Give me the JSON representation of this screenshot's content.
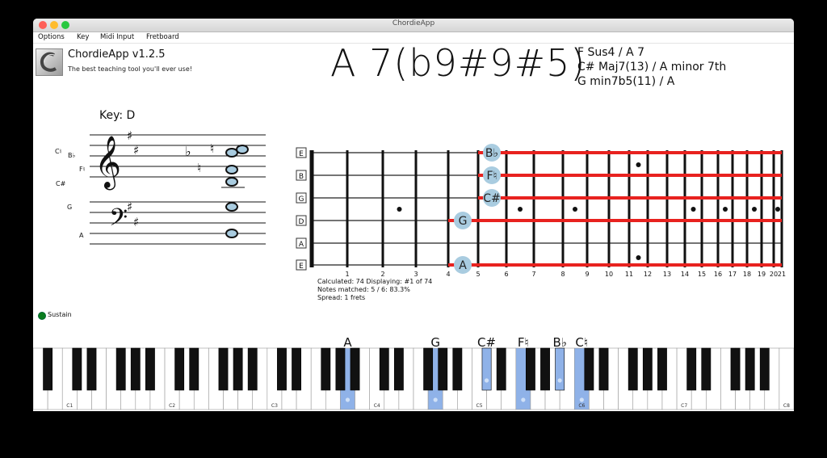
{
  "window": {
    "title": "ChordieApp",
    "close_color": "#fe5f57",
    "min_color": "#febc2e",
    "max_color": "#28c840"
  },
  "menu": [
    "Options",
    "Key",
    "Midi Input",
    "Fretboard"
  ],
  "app": {
    "name": "ChordieApp v1.2.5",
    "tagline": "The best teaching tool you'll ever use!"
  },
  "chord": {
    "main": "A 7(b9#9#5)",
    "alternates": [
      "F Sus4 / A 7",
      "C# Maj7(13) / A minor 7th",
      "G min7b5(11) / A"
    ]
  },
  "staff": {
    "key_label": "Key: D",
    "note_labels": [
      "C♮",
      "B♭",
      "F♮",
      "C#",
      "G",
      "A"
    ]
  },
  "fretboard": {
    "string_labels": [
      "E",
      "B",
      "G",
      "D",
      "A",
      "E"
    ],
    "fret_numbers": [
      "1",
      "2",
      "3",
      "4",
      "5",
      "6",
      "7",
      "8",
      "9",
      "10",
      "11",
      "12",
      "13",
      "14",
      "15",
      "16",
      "17",
      "18",
      "19",
      "20",
      "21"
    ],
    "played_notes": [
      {
        "label": "B♭",
        "string": 1,
        "fret": 6
      },
      {
        "label": "F♮",
        "string": 2,
        "fret": 6
      },
      {
        "label": "C#",
        "string": 3,
        "fret": 6
      },
      {
        "label": "G",
        "string": 4,
        "fret": 5
      },
      {
        "label": "A",
        "string": 6,
        "fret": 5
      }
    ],
    "highlight_color": "#e8221f",
    "note_color": "#a9cce0",
    "stats": [
      "Calculated: 74   Displaying: #1 of 74",
      "Notes matched: 5 / 6: 83.3%",
      "Spread: 1 frets"
    ]
  },
  "sustain": {
    "label": "Sustain",
    "color": "#0a7d1e"
  },
  "piano": {
    "octave_labels": [
      "C1",
      "C2",
      "C3",
      "C4",
      "C5",
      "C6",
      "C7",
      "C8"
    ],
    "highlighted_keys": [
      {
        "label": "A",
        "note": "A3"
      },
      {
        "label": "G",
        "note": "G4"
      },
      {
        "label": "C#",
        "note": "C#5"
      },
      {
        "label": "F♮",
        "note": "F5"
      },
      {
        "label": "B♭",
        "note": "Bb5"
      },
      {
        "label": "C♮",
        "note": "C6"
      }
    ],
    "highlight_color": "#8fb2e8"
  }
}
